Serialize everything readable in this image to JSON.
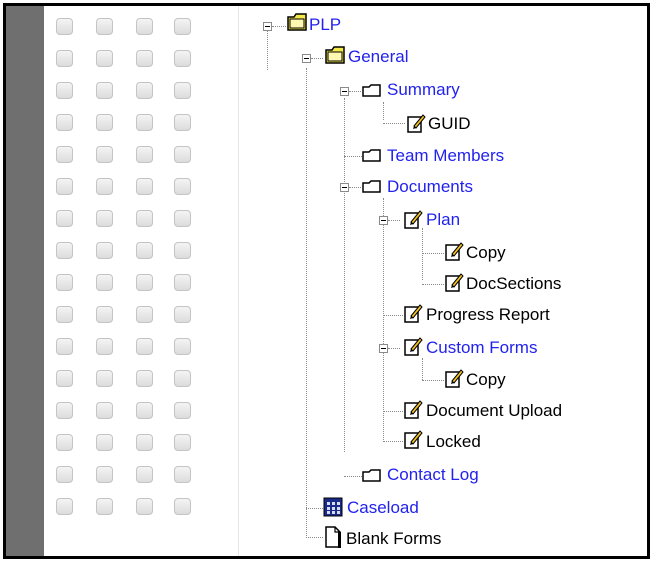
{
  "tree": {
    "plp": {
      "label": "PLP"
    },
    "general": {
      "label": "General"
    },
    "summary": {
      "label": "Summary"
    },
    "guid": {
      "label": "GUID"
    },
    "team_members": {
      "label": "Team Members"
    },
    "documents": {
      "label": "Documents"
    },
    "plan": {
      "label": "Plan"
    },
    "plan_copy": {
      "label": "Copy"
    },
    "doc_sections": {
      "label": "DocSections"
    },
    "progress_report": {
      "label": "Progress Report"
    },
    "custom_forms": {
      "label": "Custom Forms"
    },
    "custom_forms_copy": {
      "label": "Copy"
    },
    "document_upload": {
      "label": "Document Upload"
    },
    "locked": {
      "label": "Locked"
    },
    "contact_log": {
      "label": "Contact Log"
    },
    "caseload": {
      "label": "Caseload"
    },
    "blank_forms": {
      "label": "Blank Forms"
    }
  },
  "icons": {
    "folder": "folder-open-icon",
    "section": "section-tab-icon",
    "form": "form-pencil-icon",
    "grid": "grid-icon",
    "page": "page-icon"
  },
  "colors": {
    "link": "#2222ee",
    "text": "#000000",
    "folder": "#f5e84a",
    "sidebar": "#6f6f6f"
  }
}
